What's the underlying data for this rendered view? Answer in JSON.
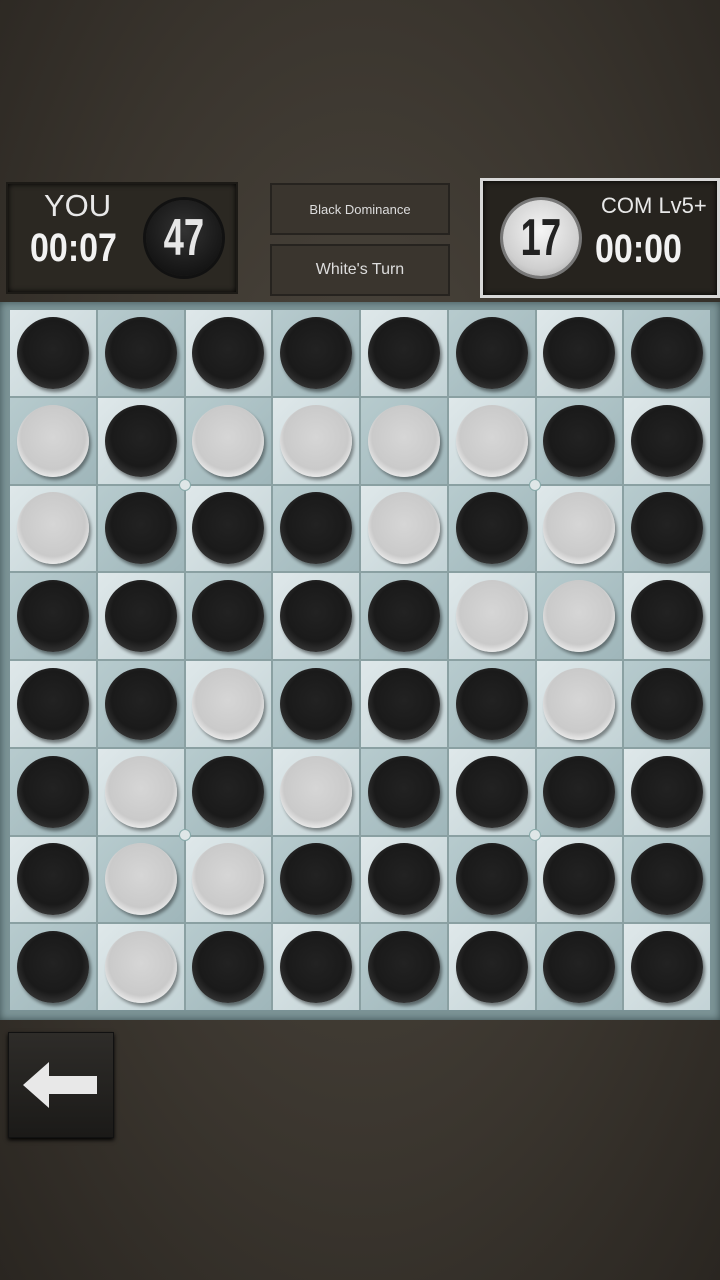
{
  "player": {
    "name": "YOU",
    "timer": "00:07",
    "score": "47",
    "color": "black"
  },
  "opponent": {
    "name": "COM Lv5+",
    "timer": "00:00",
    "score": "17",
    "color": "white"
  },
  "status": {
    "dominance": "Black Dominance",
    "turn": "White's Turn"
  },
  "board": [
    "BBBBBBBB",
    "WBWWWWBB",
    "WBBBWBWB",
    "BBBBBWWB",
    "BBWBBBWB",
    "BWBWBBBB",
    "BWWBBBBB",
    "BWBBBBBB"
  ],
  "back_button": {
    "icon": "arrow-left-icon"
  }
}
